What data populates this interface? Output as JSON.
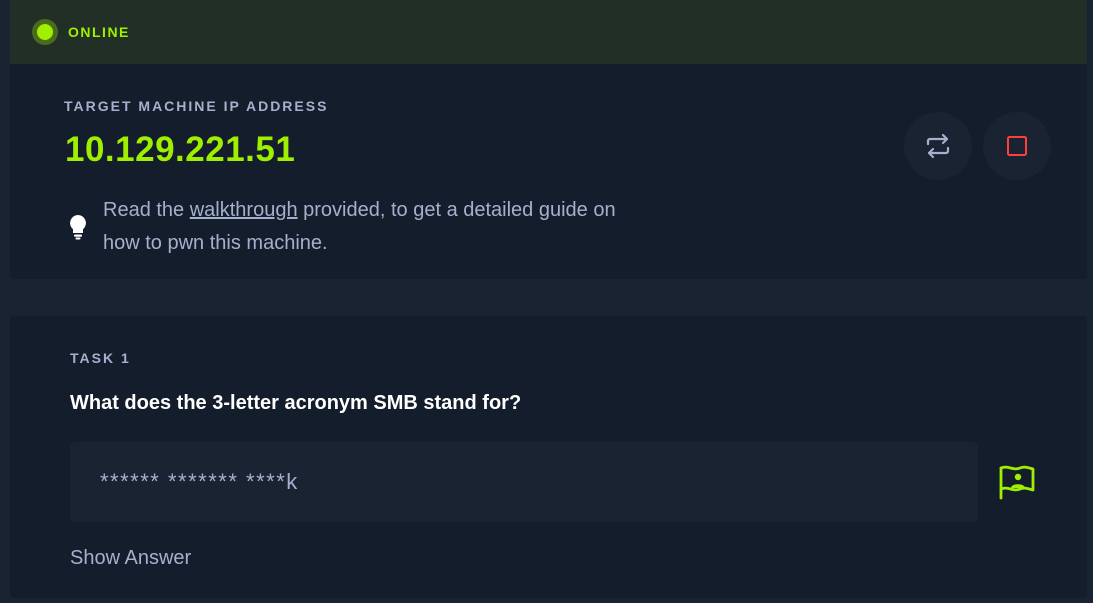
{
  "status": {
    "text": "ONLINE",
    "color": "#9fef00"
  },
  "machine": {
    "ip_label": "TARGET MACHINE IP ADDRESS",
    "ip": "10.129.221.51",
    "reset_icon": "reset-machine-icon",
    "stop_icon": "stop-machine-icon",
    "hint": {
      "icon": "lightbulb-icon",
      "before": "Read the ",
      "link": "walkthrough",
      "after": " provided, to get a detailed guide on how to pwn this machine."
    }
  },
  "task": {
    "label": "TASK 1",
    "question": "What does the 3-letter acronym SMB stand for?",
    "answer_value": "****** ******* ****k",
    "submit_icon": "flag-submit-icon",
    "show_answer": "Show Answer"
  },
  "colors": {
    "accent": "#9fef00",
    "stop": "#ff3e3e",
    "text_muted": "#a4b1cd",
    "card_bg": "#141d2b",
    "page_bg": "#1a2332"
  }
}
